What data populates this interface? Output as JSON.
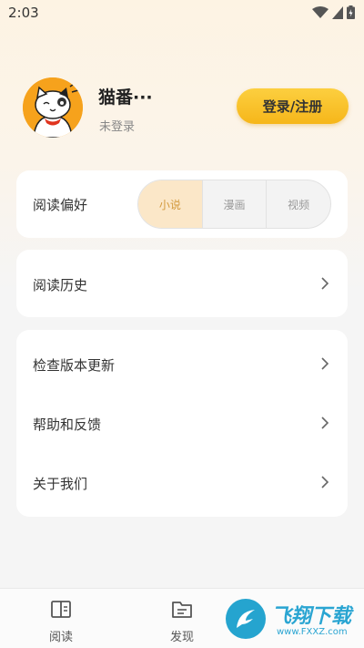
{
  "status_bar": {
    "time": "2:03"
  },
  "profile": {
    "username": "猫番···",
    "login_status": "未登录",
    "login_button": "登录/注册"
  },
  "preference": {
    "label": "阅读偏好",
    "options": [
      "小说",
      "漫画",
      "视频"
    ],
    "selected": "小说"
  },
  "history": {
    "label": "阅读历史"
  },
  "menu": {
    "items": [
      {
        "label": "检查版本更新"
      },
      {
        "label": "帮助和反馈"
      },
      {
        "label": "关于我们"
      }
    ]
  },
  "bottom_nav": {
    "items": [
      {
        "label": "阅读",
        "icon": "book-icon"
      },
      {
        "label": "发现",
        "icon": "discover-icon"
      }
    ]
  },
  "watermark": {
    "text": "飞翔下载",
    "sub": "www.FXXZ.com"
  },
  "colors": {
    "accent": "#f6b61a",
    "selected_tab_bg": "#fbe7c8",
    "selected_tab_text": "#d39a3d"
  }
}
